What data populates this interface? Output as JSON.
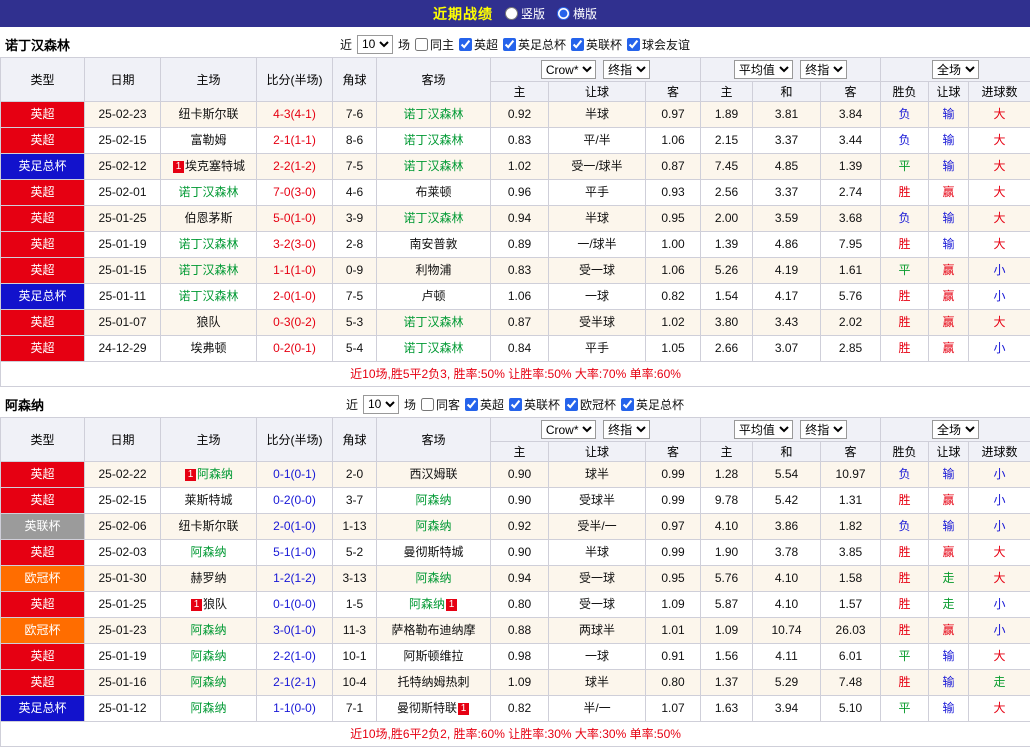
{
  "topbar": {
    "title": "近期战绩",
    "view_options": [
      {
        "label": "竖版",
        "checked": false
      },
      {
        "label": "横版",
        "checked": true
      }
    ]
  },
  "league_colors": {
    "英超": "#e60012",
    "英足总杯": "#1212cc",
    "英联杯": "#9b9b9b",
    "欧冠杯": "#ff6d00"
  },
  "value_colors": {
    "red": "#e60012",
    "blue": "#1717d6",
    "green": "#089b2d"
  },
  "columns": {
    "type": "类型",
    "date": "日期",
    "home": "主场",
    "score": "比分(半场)",
    "corner": "角球",
    "away": "客场",
    "ah_home": "主",
    "ah_line": "让球",
    "ah_away": "客",
    "eu_home": "主",
    "eu_draw": "和",
    "eu_away": "客",
    "result": "胜负",
    "ah_result": "让球",
    "goals": "进球数"
  },
  "sections": [
    {
      "team": "诺丁汉森林",
      "filter": {
        "prefix": "近",
        "count": "10",
        "suffix": "场",
        "same": {
          "label": "同主",
          "checked": false
        },
        "leagues": [
          {
            "label": "英超",
            "checked": true
          },
          {
            "label": "英足总杯",
            "checked": true
          },
          {
            "label": "英联杯",
            "checked": true
          },
          {
            "label": "球会友谊",
            "checked": true
          }
        ]
      },
      "controls": {
        "company": "Crow*",
        "stage": "终指",
        "euro_source": "平均值",
        "euro_stage": "终指",
        "scope": "全场"
      },
      "rows": [
        {
          "type": "英超",
          "date": "25-02-23",
          "home": "纽卡斯尔联",
          "home_green": false,
          "home_badge": null,
          "score": "4-3(4-1)",
          "score_color": "red",
          "corner": "7-6",
          "away": "诺丁汉森林",
          "away_green": true,
          "away_badge": null,
          "ah_home": "0.92",
          "ah_line": "半球",
          "ah_away": "0.97",
          "eu_home": "1.89",
          "eu_draw": "3.81",
          "eu_away": "3.84",
          "result": "负",
          "result_color": "blue",
          "ah_result": "输",
          "ah_result_color": "blue",
          "goals": "大",
          "goals_color": "red"
        },
        {
          "type": "英超",
          "date": "25-02-15",
          "home": "富勒姆",
          "home_green": false,
          "home_badge": null,
          "score": "2-1(1-1)",
          "score_color": "red",
          "corner": "8-6",
          "away": "诺丁汉森林",
          "away_green": true,
          "away_badge": null,
          "ah_home": "0.83",
          "ah_line": "平/半",
          "ah_away": "1.06",
          "eu_home": "2.15",
          "eu_draw": "3.37",
          "eu_away": "3.44",
          "result": "负",
          "result_color": "blue",
          "ah_result": "输",
          "ah_result_color": "blue",
          "goals": "大",
          "goals_color": "red"
        },
        {
          "type": "英足总杯",
          "date": "25-02-12",
          "home": "埃克塞特城",
          "home_green": false,
          "home_badge": "before",
          "score": "2-2(1-2)",
          "score_color": "red",
          "corner": "7-5",
          "away": "诺丁汉森林",
          "away_green": true,
          "away_badge": null,
          "ah_home": "1.02",
          "ah_line": "受一/球半",
          "ah_away": "0.87",
          "eu_home": "7.45",
          "eu_draw": "4.85",
          "eu_away": "1.39",
          "result": "平",
          "result_color": "green",
          "ah_result": "输",
          "ah_result_color": "blue",
          "goals": "大",
          "goals_color": "red"
        },
        {
          "type": "英超",
          "date": "25-02-01",
          "home": "诺丁汉森林",
          "home_green": true,
          "home_badge": null,
          "score": "7-0(3-0)",
          "score_color": "red",
          "corner": "4-6",
          "away": "布莱顿",
          "away_green": false,
          "away_badge": null,
          "ah_home": "0.96",
          "ah_line": "平手",
          "ah_away": "0.93",
          "eu_home": "2.56",
          "eu_draw": "3.37",
          "eu_away": "2.74",
          "result": "胜",
          "result_color": "red",
          "ah_result": "赢",
          "ah_result_color": "red",
          "goals": "大",
          "goals_color": "red"
        },
        {
          "type": "英超",
          "date": "25-01-25",
          "home": "伯恩茅斯",
          "home_green": false,
          "home_badge": null,
          "score": "5-0(1-0)",
          "score_color": "red",
          "corner": "3-9",
          "away": "诺丁汉森林",
          "away_green": true,
          "away_badge": null,
          "ah_home": "0.94",
          "ah_line": "半球",
          "ah_away": "0.95",
          "eu_home": "2.00",
          "eu_draw": "3.59",
          "eu_away": "3.68",
          "result": "负",
          "result_color": "blue",
          "ah_result": "输",
          "ah_result_color": "blue",
          "goals": "大",
          "goals_color": "red"
        },
        {
          "type": "英超",
          "date": "25-01-19",
          "home": "诺丁汉森林",
          "home_green": true,
          "home_badge": null,
          "score": "3-2(3-0)",
          "score_color": "red",
          "corner": "2-8",
          "away": "南安普敦",
          "away_green": false,
          "away_badge": null,
          "ah_home": "0.89",
          "ah_line": "一/球半",
          "ah_away": "1.00",
          "eu_home": "1.39",
          "eu_draw": "4.86",
          "eu_away": "7.95",
          "result": "胜",
          "result_color": "red",
          "ah_result": "输",
          "ah_result_color": "blue",
          "goals": "大",
          "goals_color": "red"
        },
        {
          "type": "英超",
          "date": "25-01-15",
          "home": "诺丁汉森林",
          "home_green": true,
          "home_badge": null,
          "score": "1-1(1-0)",
          "score_color": "red",
          "corner": "0-9",
          "away": "利物浦",
          "away_green": false,
          "away_badge": null,
          "ah_home": "0.83",
          "ah_line": "受一球",
          "ah_away": "1.06",
          "eu_home": "5.26",
          "eu_draw": "4.19",
          "eu_away": "1.61",
          "result": "平",
          "result_color": "green",
          "ah_result": "赢",
          "ah_result_color": "red",
          "goals": "小",
          "goals_color": "blue"
        },
        {
          "type": "英足总杯",
          "date": "25-01-11",
          "home": "诺丁汉森林",
          "home_green": true,
          "home_badge": null,
          "score": "2-0(1-0)",
          "score_color": "red",
          "corner": "7-5",
          "away": "卢顿",
          "away_green": false,
          "away_badge": null,
          "ah_home": "1.06",
          "ah_line": "一球",
          "ah_away": "0.82",
          "eu_home": "1.54",
          "eu_draw": "4.17",
          "eu_away": "5.76",
          "result": "胜",
          "result_color": "red",
          "ah_result": "赢",
          "ah_result_color": "red",
          "goals": "小",
          "goals_color": "blue"
        },
        {
          "type": "英超",
          "date": "25-01-07",
          "home": "狼队",
          "home_green": false,
          "home_badge": null,
          "score": "0-3(0-2)",
          "score_color": "red",
          "corner": "5-3",
          "away": "诺丁汉森林",
          "away_green": true,
          "away_badge": null,
          "ah_home": "0.87",
          "ah_line": "受半球",
          "ah_away": "1.02",
          "eu_home": "3.80",
          "eu_draw": "3.43",
          "eu_away": "2.02",
          "result": "胜",
          "result_color": "red",
          "ah_result": "赢",
          "ah_result_color": "red",
          "goals": "大",
          "goals_color": "red"
        },
        {
          "type": "英超",
          "date": "24-12-29",
          "home": "埃弗顿",
          "home_green": false,
          "home_badge": null,
          "score": "0-2(0-1)",
          "score_color": "red",
          "corner": "5-4",
          "away": "诺丁汉森林",
          "away_green": true,
          "away_badge": null,
          "ah_home": "0.84",
          "ah_line": "平手",
          "ah_away": "1.05",
          "eu_home": "2.66",
          "eu_draw": "3.07",
          "eu_away": "2.85",
          "result": "胜",
          "result_color": "red",
          "ah_result": "赢",
          "ah_result_color": "red",
          "goals": "小",
          "goals_color": "blue"
        }
      ],
      "summary": "近10场,胜5平2负3, 胜率:50% 让胜率:50% 大率:70% 单率:60%"
    },
    {
      "team": "阿森纳",
      "filter": {
        "prefix": "近",
        "count": "10",
        "suffix": "场",
        "same": {
          "label": "同客",
          "checked": false
        },
        "leagues": [
          {
            "label": "英超",
            "checked": true
          },
          {
            "label": "英联杯",
            "checked": true
          },
          {
            "label": "欧冠杯",
            "checked": true
          },
          {
            "label": "英足总杯",
            "checked": true
          }
        ]
      },
      "controls": {
        "company": "Crow*",
        "stage": "终指",
        "euro_source": "平均值",
        "euro_stage": "终指",
        "scope": "全场"
      },
      "rows": [
        {
          "type": "英超",
          "date": "25-02-22",
          "home": "阿森纳",
          "home_green": true,
          "home_badge": "before",
          "score": "0-1(0-1)",
          "score_color": "blue",
          "corner": "2-0",
          "away": "西汉姆联",
          "away_green": false,
          "away_badge": null,
          "ah_home": "0.90",
          "ah_line": "球半",
          "ah_away": "0.99",
          "eu_home": "1.28",
          "eu_draw": "5.54",
          "eu_away": "10.97",
          "result": "负",
          "result_color": "blue",
          "ah_result": "输",
          "ah_result_color": "blue",
          "goals": "小",
          "goals_color": "blue"
        },
        {
          "type": "英超",
          "date": "25-02-15",
          "home": "莱斯特城",
          "home_green": false,
          "home_badge": null,
          "score": "0-2(0-0)",
          "score_color": "blue",
          "corner": "3-7",
          "away": "阿森纳",
          "away_green": true,
          "away_badge": null,
          "ah_home": "0.90",
          "ah_line": "受球半",
          "ah_away": "0.99",
          "eu_home": "9.78",
          "eu_draw": "5.42",
          "eu_away": "1.31",
          "result": "胜",
          "result_color": "red",
          "ah_result": "赢",
          "ah_result_color": "red",
          "goals": "小",
          "goals_color": "blue"
        },
        {
          "type": "英联杯",
          "date": "25-02-06",
          "home": "纽卡斯尔联",
          "home_green": false,
          "home_badge": null,
          "score": "2-0(1-0)",
          "score_color": "blue",
          "corner": "1-13",
          "away": "阿森纳",
          "away_green": true,
          "away_badge": null,
          "ah_home": "0.92",
          "ah_line": "受半/一",
          "ah_away": "0.97",
          "eu_home": "4.10",
          "eu_draw": "3.86",
          "eu_away": "1.82",
          "result": "负",
          "result_color": "blue",
          "ah_result": "输",
          "ah_result_color": "blue",
          "goals": "小",
          "goals_color": "blue"
        },
        {
          "type": "英超",
          "date": "25-02-03",
          "home": "阿森纳",
          "home_green": true,
          "home_badge": null,
          "score": "5-1(1-0)",
          "score_color": "blue",
          "corner": "5-2",
          "away": "曼彻斯特城",
          "away_green": false,
          "away_badge": null,
          "ah_home": "0.90",
          "ah_line": "半球",
          "ah_away": "0.99",
          "eu_home": "1.90",
          "eu_draw": "3.78",
          "eu_away": "3.85",
          "result": "胜",
          "result_color": "red",
          "ah_result": "赢",
          "ah_result_color": "red",
          "goals": "大",
          "goals_color": "red"
        },
        {
          "type": "欧冠杯",
          "date": "25-01-30",
          "home": "赫罗纳",
          "home_green": false,
          "home_badge": null,
          "score": "1-2(1-2)",
          "score_color": "blue",
          "corner": "3-13",
          "away": "阿森纳",
          "away_green": true,
          "away_badge": null,
          "ah_home": "0.94",
          "ah_line": "受一球",
          "ah_away": "0.95",
          "eu_home": "5.76",
          "eu_draw": "4.10",
          "eu_away": "1.58",
          "result": "胜",
          "result_color": "red",
          "ah_result": "走",
          "ah_result_color": "green",
          "goals": "大",
          "goals_color": "red"
        },
        {
          "type": "英超",
          "date": "25-01-25",
          "home": "狼队",
          "home_green": false,
          "home_badge": "before",
          "score": "0-1(0-0)",
          "score_color": "blue",
          "corner": "1-5",
          "away": "阿森纳",
          "away_green": true,
          "away_badge": "after",
          "ah_home": "0.80",
          "ah_line": "受一球",
          "ah_away": "1.09",
          "eu_home": "5.87",
          "eu_draw": "4.10",
          "eu_away": "1.57",
          "result": "胜",
          "result_color": "red",
          "ah_result": "走",
          "ah_result_color": "green",
          "goals": "小",
          "goals_color": "blue"
        },
        {
          "type": "欧冠杯",
          "date": "25-01-23",
          "home": "阿森纳",
          "home_green": true,
          "home_badge": null,
          "score": "3-0(1-0)",
          "score_color": "blue",
          "corner": "11-3",
          "away": "萨格勒布迪纳摩",
          "away_green": false,
          "away_badge": null,
          "ah_home": "0.88",
          "ah_line": "两球半",
          "ah_away": "1.01",
          "eu_home": "1.09",
          "eu_draw": "10.74",
          "eu_away": "26.03",
          "result": "胜",
          "result_color": "red",
          "ah_result": "赢",
          "ah_result_color": "red",
          "goals": "小",
          "goals_color": "blue"
        },
        {
          "type": "英超",
          "date": "25-01-19",
          "home": "阿森纳",
          "home_green": true,
          "home_badge": null,
          "score": "2-2(1-0)",
          "score_color": "blue",
          "corner": "10-1",
          "away": "阿斯顿维拉",
          "away_green": false,
          "away_badge": null,
          "ah_home": "0.98",
          "ah_line": "一球",
          "ah_away": "0.91",
          "eu_home": "1.56",
          "eu_draw": "4.11",
          "eu_away": "6.01",
          "result": "平",
          "result_color": "green",
          "ah_result": "输",
          "ah_result_color": "blue",
          "goals": "大",
          "goals_color": "red"
        },
        {
          "type": "英超",
          "date": "25-01-16",
          "home": "阿森纳",
          "home_green": true,
          "home_badge": null,
          "score": "2-1(2-1)",
          "score_color": "blue",
          "corner": "10-4",
          "away": "托特纳姆热刺",
          "away_green": false,
          "away_badge": null,
          "ah_home": "1.09",
          "ah_line": "球半",
          "ah_away": "0.80",
          "eu_home": "1.37",
          "eu_draw": "5.29",
          "eu_away": "7.48",
          "result": "胜",
          "result_color": "red",
          "ah_result": "输",
          "ah_result_color": "blue",
          "goals": "走",
          "goals_color": "green"
        },
        {
          "type": "英足总杯",
          "date": "25-01-12",
          "home": "阿森纳",
          "home_green": true,
          "home_badge": null,
          "score": "1-1(0-0)",
          "score_color": "blue",
          "corner": "7-1",
          "away": "曼彻斯特联",
          "away_green": false,
          "away_badge": "after",
          "ah_home": "0.82",
          "ah_line": "半/一",
          "ah_away": "1.07",
          "eu_home": "1.63",
          "eu_draw": "3.94",
          "eu_away": "5.10",
          "result": "平",
          "result_color": "green",
          "ah_result": "输",
          "ah_result_color": "blue",
          "goals": "大",
          "goals_color": "red"
        }
      ],
      "summary": "近10场,胜6平2负2, 胜率:60% 让胜率:30% 大率:30% 单率:50%"
    }
  ]
}
